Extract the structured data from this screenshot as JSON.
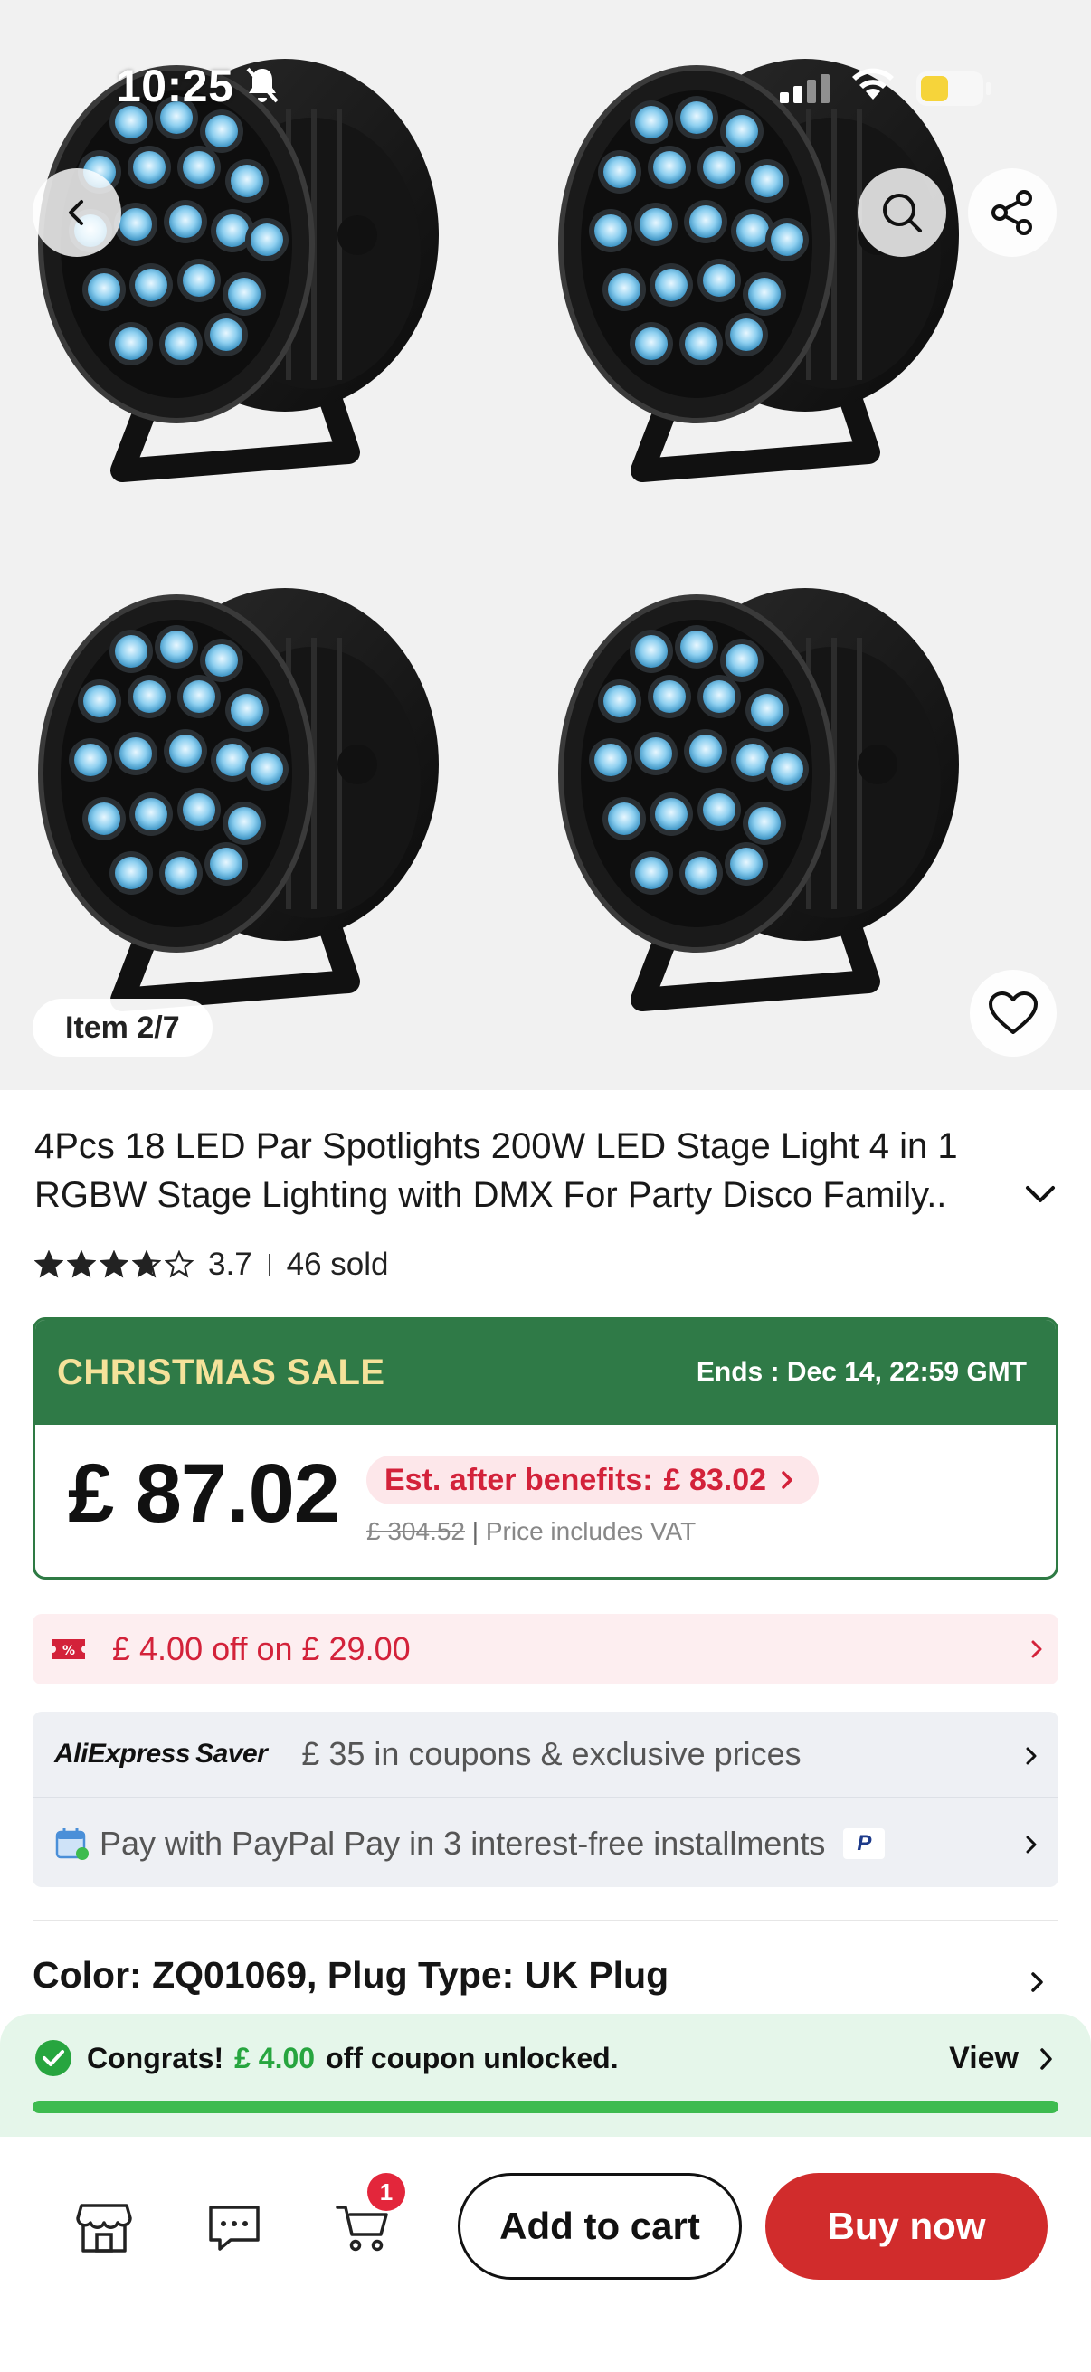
{
  "status_bar": {
    "time": "10:25"
  },
  "gallery": {
    "item_counter": "Item 2/7",
    "image_alt": "4 black LED par spotlights with blue LEDs"
  },
  "product": {
    "title": "4Pcs 18 LED Par Spotlights 200W LED Stage Light 4 in 1 RGBW Stage Lighting with DMX For Party Disco Family..",
    "rating": "3.7",
    "rating_value": 3.7,
    "sold": "46 sold"
  },
  "sale": {
    "label": "CHRISTMAS SALE",
    "ends": "Ends : Dec 14, 22:59 GMT",
    "price": "£ 87.02",
    "benefit_label": "Est. after benefits:",
    "benefit_price": "£ 83.02",
    "original_price": "£ 304.52",
    "vat_note": "Price includes VAT"
  },
  "coupon": {
    "text": "£ 4.00 off on  £ 29.00"
  },
  "offers": {
    "saver_logo_left": "AliExpress",
    "saver_logo_right": "Saver",
    "saver_text": "£ 35 in coupons & exclusive prices",
    "paypal_text": "Pay with PayPal Pay in 3 interest-free installments",
    "paypal_badge": "P"
  },
  "variant": {
    "label": "Color: ZQ01069, Plug Type: UK Plug"
  },
  "congrats": {
    "prefix": "Congrats!",
    "amount": "£ 4.00",
    "suffix": "off coupon unlocked.",
    "view": "View",
    "progress": 1.0
  },
  "bottom_bar": {
    "cart_count": "1",
    "add_to_cart": "Add to cart",
    "buy_now": "Buy now"
  },
  "colors": {
    "sale_green": "#2f7a47",
    "sale_gold": "#f5e29a",
    "price_red": "#d3223a",
    "buy_red": "#d12c2c",
    "progress_green": "#3dbb4f"
  }
}
